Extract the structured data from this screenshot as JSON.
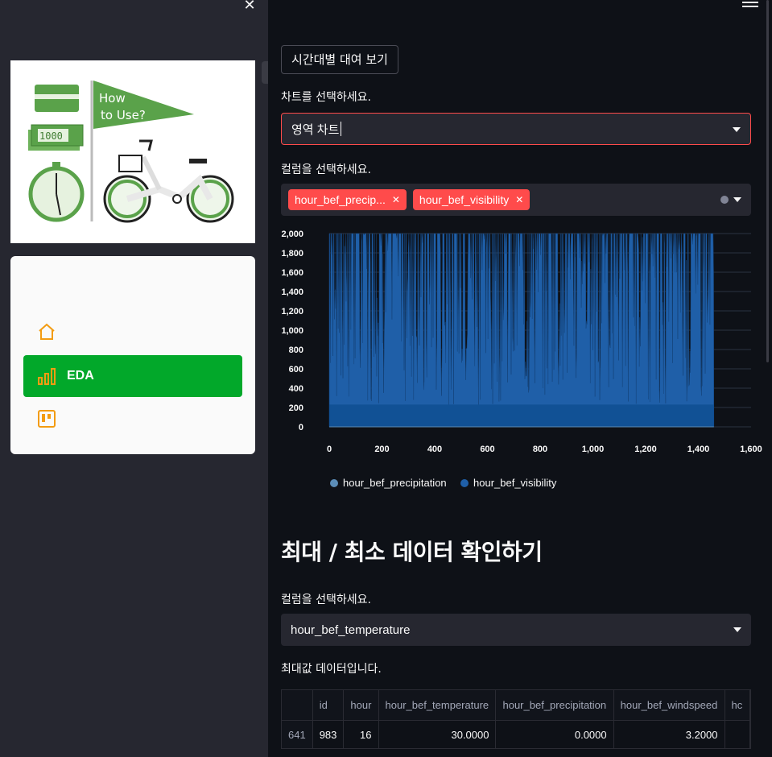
{
  "sidebar": {
    "close_glyph": "✕",
    "logo": {
      "flag_text_1": "How",
      "flag_text_2": "to Use?",
      "bill_text": "1000"
    },
    "menu": [
      {
        "label": "",
        "icon": "house-icon",
        "active": false
      },
      {
        "label": "EDA",
        "icon": "bar-chart-icon",
        "active": true
      },
      {
        "label": "",
        "icon": "kanban-icon",
        "active": false
      }
    ],
    "accent_color": "#02a82a",
    "icon_color": "#f39c12"
  },
  "main": {
    "time_button_label": "시간대별 대여 보기",
    "chart_select": {
      "label": "차트를 선택하세요.",
      "value": "영역 차트"
    },
    "column_multiselect": {
      "label": "컬럼을 선택하세요.",
      "tags": [
        "hour_bef_precip...",
        "hour_bef_visibility"
      ]
    },
    "section_title": "최대 / 최소 데이터 확인하기",
    "column_select": {
      "label": "컬럼을 선택하세요.",
      "value": "hour_bef_temperature"
    },
    "max_caption": "최대값 데이터입니다.",
    "table": {
      "columns": [
        "",
        "id",
        "hour",
        "hour_bef_temperature",
        "hour_bef_precipitation",
        "hour_bef_windspeed",
        "hc"
      ],
      "rows": [
        [
          "641",
          "983",
          "16",
          "30.0000",
          "0.0000",
          "3.2000",
          ""
        ]
      ]
    }
  },
  "chart_data": {
    "type": "area",
    "x_ticks": [
      "0",
      "200",
      "400",
      "600",
      "800",
      "1,000",
      "1,200",
      "1,400",
      "1,600"
    ],
    "y_ticks": [
      "0",
      "200",
      "400",
      "600",
      "800",
      "1,000",
      "1,200",
      "1,400",
      "1,600",
      "1,800",
      "2,000"
    ],
    "xlim": [
      0,
      1600
    ],
    "ylim": [
      0,
      2000
    ],
    "x_range": [
      0,
      1459
    ],
    "legend_position": "bottom",
    "grid": true,
    "series": [
      {
        "name": "hour_bef_precipitation",
        "color": "#5b8db8",
        "level": 0
      },
      {
        "name": "hour_bef_visibility",
        "color": "#1f5fa8",
        "min": 230,
        "max": 2000
      }
    ]
  }
}
